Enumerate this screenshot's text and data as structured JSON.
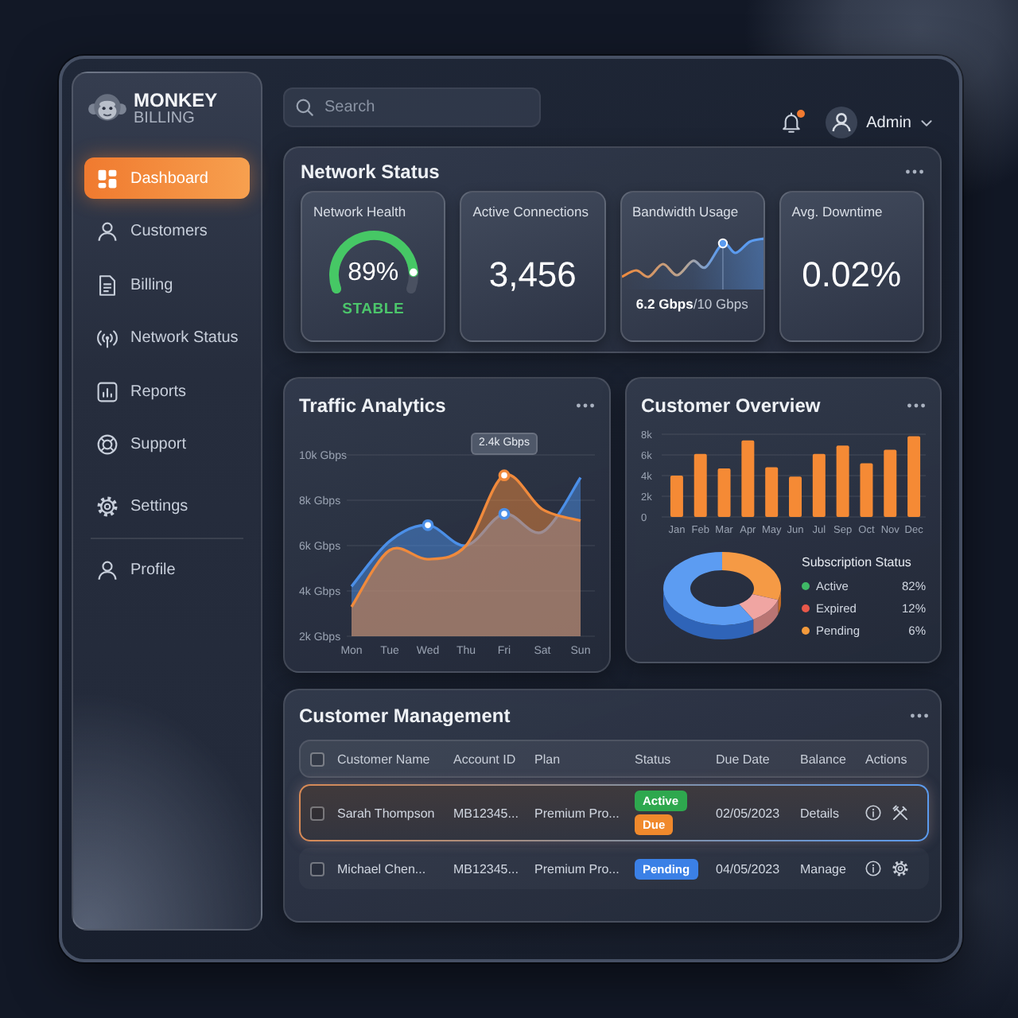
{
  "brand": {
    "name": "MONKEY",
    "subtitle": "BILLING"
  },
  "sidebar": {
    "items": [
      {
        "label": "Dashboard",
        "selected": true
      },
      {
        "label": "Customers",
        "selected": false
      },
      {
        "label": "Billing",
        "selected": false
      },
      {
        "label": "Network Status",
        "selected": false
      },
      {
        "label": "Reports",
        "selected": false
      },
      {
        "label": "Support",
        "selected": false
      },
      {
        "label": "Settings",
        "selected": false
      }
    ],
    "bottom_items": [
      {
        "label": "Profile",
        "selected": false
      }
    ]
  },
  "topbar": {
    "search": {
      "placeholder": "Search"
    },
    "notification_dot": true,
    "user": "Admin"
  },
  "network_status": {
    "title": "Network Status",
    "cards": [
      {
        "kind": "gauge",
        "title": "Network Health",
        "value": "89%",
        "level": 0.89,
        "status": "STABLE"
      },
      {
        "kind": "number",
        "title": "Active Connections",
        "value": "3,456"
      },
      {
        "kind": "sparkline",
        "title": "Bandwidth Usage",
        "value": "**6.2 Gbps**/10 Gbps"
      },
      {
        "kind": "number",
        "title": "Avg. Downtime",
        "value": "0.02%"
      }
    ]
  },
  "traffic_analytics": {
    "title": "Traffic Analytics",
    "chart_data": {
      "type": "area",
      "categories": [
        "Mon",
        "Tue",
        "Wed",
        "Thu",
        "Fri",
        "Sat",
        "Sun"
      ],
      "series": [
        {
          "color": "#4b8fe8",
          "values": [
            4200,
            6200,
            6900,
            6000,
            7400,
            6600,
            9000
          ]
        },
        {
          "color": "#f08a3c",
          "values": [
            3300,
            5800,
            5400,
            6000,
            9100,
            7600,
            7100
          ]
        }
      ],
      "ylim": [
        2000,
        10000
      ],
      "yticks": [
        {
          "value": 2000,
          "label": "2k Gbps"
        },
        {
          "value": 4000,
          "label": "4k Gbps"
        },
        {
          "value": 6000,
          "label": "6k Gbps"
        },
        {
          "value": 8000,
          "label": "8k Gbps"
        },
        {
          "value": 10000,
          "label": "10k Gbps"
        }
      ],
      "grid": true,
      "annotations": [
        {
          "x": "Wed"
        },
        {
          "x": "Fri",
          "text": "2.4k Gbps"
        }
      ]
    }
  },
  "customer_overview": {
    "title": "Customer Overview",
    "chart_data": {
      "type": "bar",
      "categories": [
        "Jan",
        "Feb",
        "Mar",
        "Apr",
        "May",
        "Jun",
        "Jul",
        "Sep",
        "Oct",
        "Nov",
        "Dec"
      ],
      "series": [
        {
          "color": "#f58a35",
          "values": [
            4000,
            6100,
            4700,
            7400,
            4800,
            3900,
            6100,
            6900,
            5200,
            6500,
            7800
          ]
        }
      ],
      "ylim": [
        0,
        8000
      ],
      "yticks": [
        {
          "value": 0,
          "label": "0"
        },
        {
          "value": 2000,
          "label": "2k"
        },
        {
          "value": 4000,
          "label": "4k"
        },
        {
          "value": 6000,
          "label": "6k"
        },
        {
          "value": 8000,
          "label": "8k"
        }
      ],
      "grid": true
    },
    "subscription_status": {
      "title": "Subscription Status",
      "items": [
        {
          "label": "Active",
          "value": "82%",
          "color": "#3fb866"
        },
        {
          "label": "Expired",
          "value": "12%",
          "color": "#e8584a"
        },
        {
          "label": "Pending",
          "value": "6%",
          "color": "#f39a3c"
        }
      ]
    }
  },
  "customer_management": {
    "title": "Customer Management",
    "columns": [
      "Customer Name",
      "Account ID",
      "Plan",
      "Status",
      "Due Date",
      "Balance",
      "Actions"
    ],
    "select_all_checked": false,
    "rows": [
      {
        "selected": true,
        "checked": false,
        "customer_name": "Sarah Thompson",
        "account_id": "MB12345...",
        "plan": "Premium Pro...",
        "status": [
          {
            "label": "Active",
            "color": "#2ea84e"
          },
          {
            "label": "Due",
            "color": "#f0892c"
          }
        ],
        "due_date": "02/05/2023",
        "balance": "Details"
      },
      {
        "selected": false,
        "checked": false,
        "customer_name": "Michael Chen...",
        "account_id": "MB12345...",
        "plan": "Premium Pro...",
        "status": [
          {
            "label": "Pending",
            "color": "#3b80e6"
          }
        ],
        "due_date": "04/05/2023",
        "balance": "Manage"
      }
    ]
  }
}
